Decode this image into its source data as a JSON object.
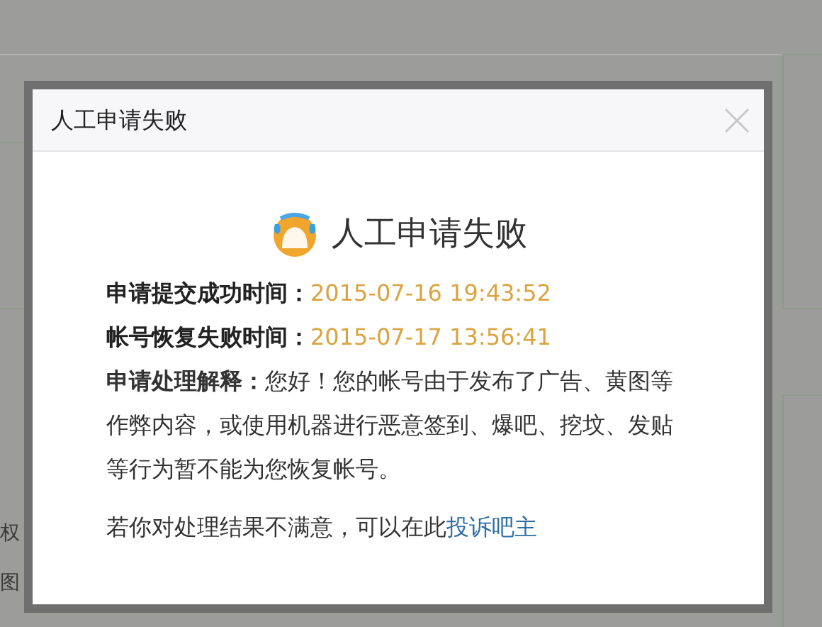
{
  "background": {
    "texts": [
      "权",
      "图"
    ]
  },
  "dialog": {
    "title": "人工申请失败",
    "heading": "人工申请失败",
    "fields": [
      {
        "label": "申请提交成功时间：",
        "value": "2015-07-16 19:43:52"
      },
      {
        "label": "帐号恢复失败时间：",
        "value": "2015-07-17 13:56:41"
      }
    ],
    "explanation": "**申请处理解释：**您好！您的帐号由于发布了广告、黄图等作弊内容，或使用机器进行恶意签到、爆吧、挖坟、发贴等行为暂不能为您恢复帐号。",
    "footer_text": "若你对处理结果不满意，可以在此",
    "footer_link": "投诉吧主"
  }
}
